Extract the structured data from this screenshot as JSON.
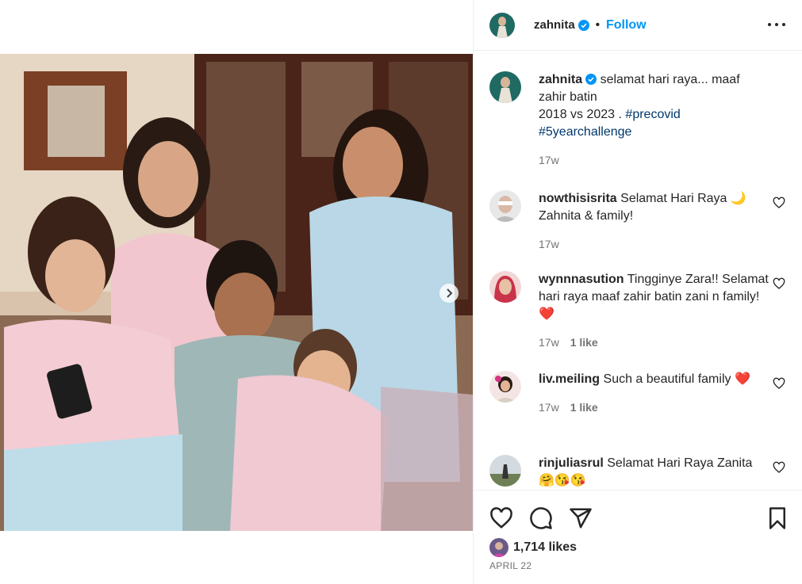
{
  "post": {
    "username": "zahnita",
    "follow_label": "Follow",
    "dot": "•"
  },
  "caption": {
    "username": "zahnita",
    "text_line1": "selamat hari raya... maaf zahir batin",
    "text_line2": "2018 vs 2023 . ",
    "hashtag1": "#precovid",
    "hashtag2": "#5yearchallenge",
    "time": "17w"
  },
  "comments": [
    {
      "username": "nowthisisrita",
      "text": "Selamat Hari Raya 🌙 Zahnita & family!",
      "time": "17w",
      "likes": ""
    },
    {
      "username": "wynnnasution",
      "text": "Tingginye Zara!! Selamat hari raya maaf zahir batin zani n family!❤️",
      "time": "17w",
      "likes": "1 like"
    },
    {
      "username": "liv.meiling",
      "text": "Such a beautiful family ❤️",
      "time": "17w",
      "likes": "1 like"
    },
    {
      "username": "rinjuliasrul",
      "text": "Selamat Hari Raya Zanita 🤗😘😘",
      "time": "",
      "likes": ""
    }
  ],
  "footer": {
    "likes": "1,714 likes",
    "date": "APRIL 22"
  },
  "colors": {
    "accent": "#0095f6",
    "text": "#262626",
    "muted": "#737373",
    "red": "#ed4956"
  },
  "icons": [
    "verified-badge-icon",
    "more-options-icon",
    "heart-icon",
    "comment-icon",
    "share-icon",
    "save-icon",
    "chevron-right-icon"
  ]
}
